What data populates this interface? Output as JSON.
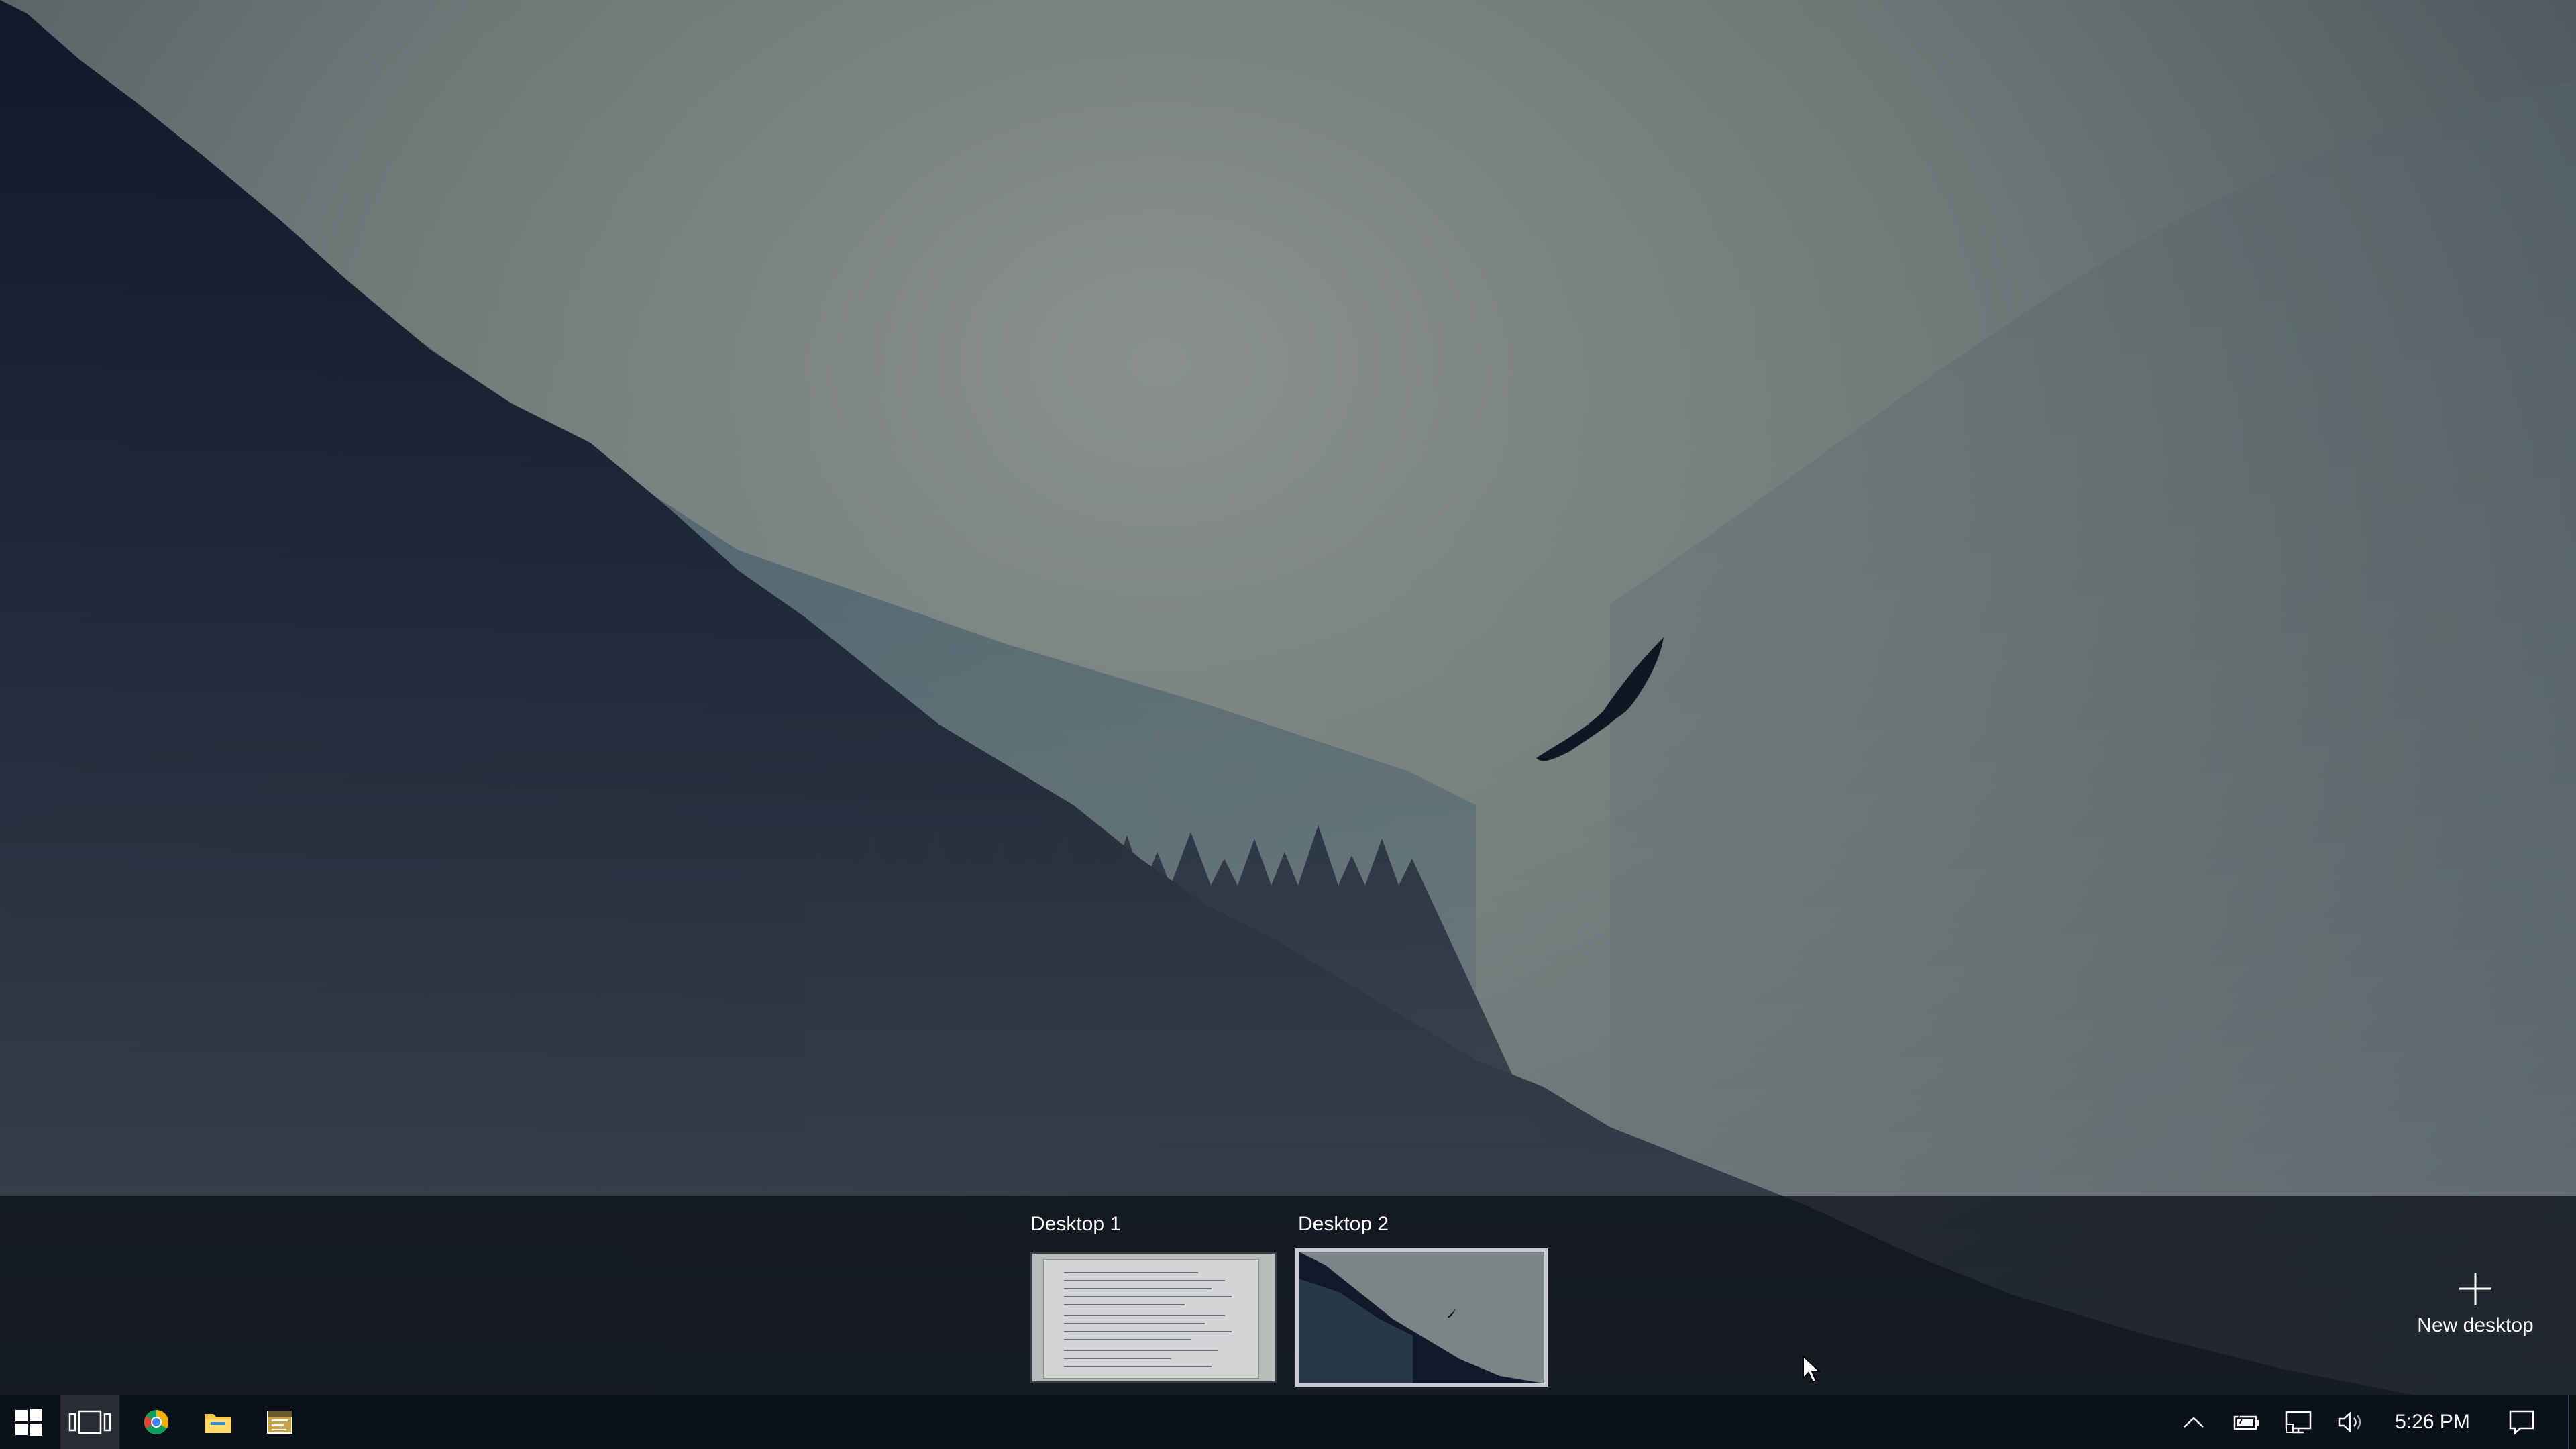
{
  "task_view": {
    "desktops": [
      {
        "label": "Desktop 1"
      },
      {
        "label": "Desktop 2"
      }
    ],
    "new_desktop_label": "New desktop"
  },
  "taskbar": {
    "start_icon": "windows-logo-icon",
    "pinned": [
      {
        "icon": "task-view-icon"
      },
      {
        "icon": "chrome-icon"
      },
      {
        "icon": "file-explorer-icon"
      },
      {
        "icon": "app-window-icon"
      }
    ],
    "tray": {
      "icons": [
        "chevron-up-icon",
        "battery-charging-icon",
        "network-icon",
        "volume-icon"
      ],
      "clock": "5:26 PM",
      "notifications_icon": "action-center-icon"
    }
  },
  "colors": {
    "taskbar_bg": "#0b111a",
    "accent_border": "#c7ccd2"
  }
}
